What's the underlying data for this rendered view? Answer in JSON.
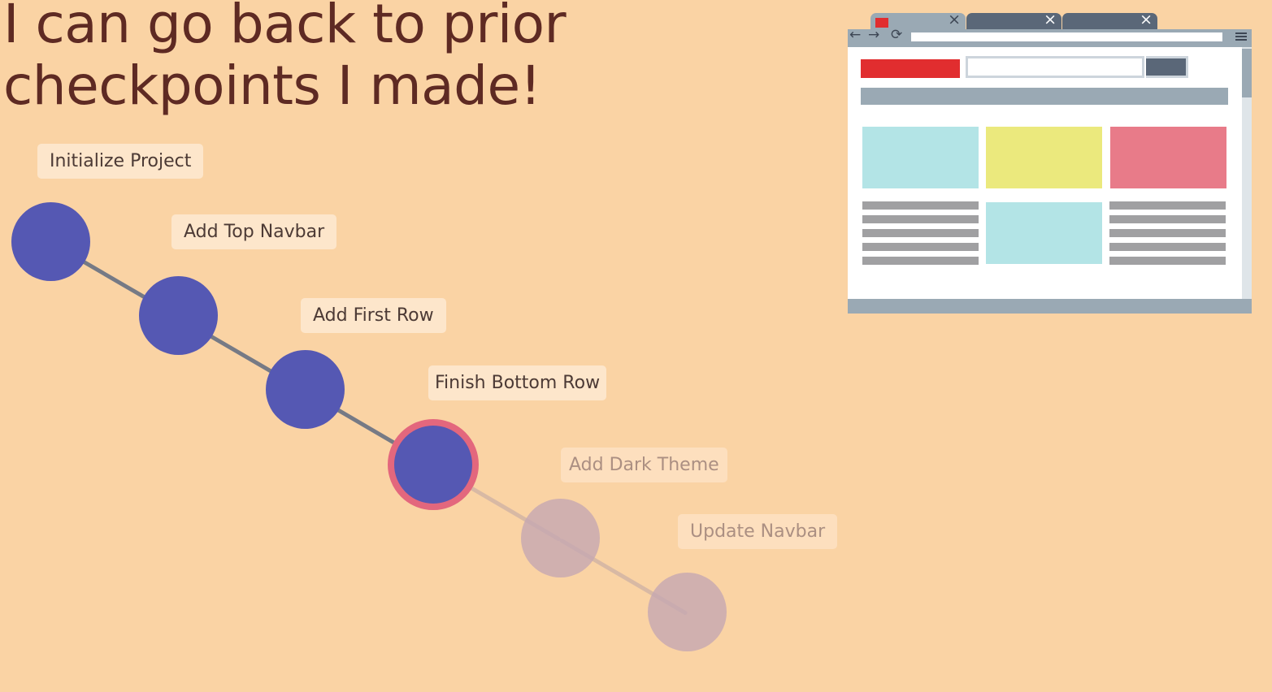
{
  "title": {
    "line1": "I can go back to prior",
    "line2": "checkpoints I made!"
  },
  "checkpoints": [
    {
      "label": "Initialize Project",
      "state": "done"
    },
    {
      "label": "Add Top Navbar",
      "state": "done"
    },
    {
      "label": "Add First Row",
      "state": "done"
    },
    {
      "label": "Finish Bottom Row",
      "state": "current"
    },
    {
      "label": "Add Dark Theme",
      "state": "future"
    },
    {
      "label": "Update Navbar",
      "state": "future"
    }
  ],
  "colors": {
    "background": "#fad3a4",
    "title_text": "#5e2a23",
    "node_done": "#5558b3",
    "node_current_ring": "#e3677d",
    "node_future": "#c4a7b2",
    "label_background": "#fde6cb",
    "line_done": "#767a85",
    "line_future": "#d8b9a4",
    "browser_red": "#e12d2f",
    "browser_cyan": "#b3e4e6",
    "browser_yellow": "#ebe97d",
    "browser_pink": "#e87b89",
    "browser_gray": "#9aa9b4"
  },
  "illustration": {
    "name": "browser-window-illustration",
    "tab_close_glyph": "×",
    "back_glyph": "←",
    "forward_glyph": "→",
    "reload_glyph": "⟳"
  }
}
